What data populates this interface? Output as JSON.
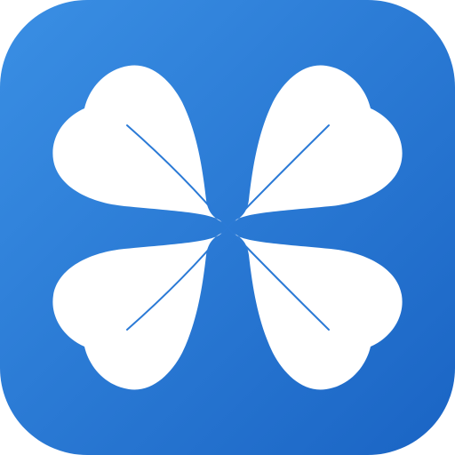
{
  "icon": {
    "name": "four-leaf-clover-icon",
    "colors": {
      "background_top": "#3A8FE4",
      "background_bottom": "#1A64C4",
      "leaf": "#FFFFFF",
      "vein": "#2B7AD6"
    }
  }
}
